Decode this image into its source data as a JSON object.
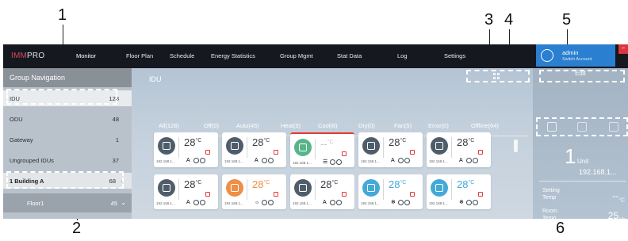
{
  "callouts": [
    "1",
    "2",
    "3",
    "4",
    "5",
    "6"
  ],
  "app": {
    "logo_part1": "IMM",
    "logo_part2": "PRO"
  },
  "nav": [
    "Monitor",
    "Floor Plan",
    "Schedule",
    "Energy Statistics",
    "Group Mgmt",
    "Stat Data",
    "Log",
    "Settings"
  ],
  "user": {
    "name": "admin",
    "action": "Switch Account",
    "close": "−"
  },
  "sidebar": {
    "title": "Group Navigation",
    "items": [
      {
        "label": "IDU",
        "count": "128"
      },
      {
        "label": "ODU",
        "count": "48"
      },
      {
        "label": "Gateway",
        "count": "1"
      },
      {
        "label": "Ungrouped IDUs",
        "count": "37"
      },
      {
        "label": "1  Building A",
        "count": "68"
      },
      {
        "label": "Floor1",
        "count": "45"
      }
    ]
  },
  "main": {
    "title": "IDU",
    "filters": [
      "All(128)",
      "Off(0)",
      "Auto(46)",
      "Heat(5)",
      "Cool(8)",
      "Dry(0)",
      "Fan(5)",
      "Error(0)",
      "Offline(64)"
    ]
  },
  "cards": [
    {
      "temp": "28",
      "unit": "°C",
      "ip": "192.168.1...",
      "mode": "A",
      "style": "dark"
    },
    {
      "temp": "28",
      "unit": "°C",
      "ip": "192.168.1...",
      "mode": "A",
      "style": "dark"
    },
    {
      "temp": "--",
      "unit": "°C",
      "ip": "192.168.1...",
      "mode": "☰",
      "style": "green"
    },
    {
      "temp": "28",
      "unit": "°C",
      "ip": "192.168.1...",
      "mode": "A",
      "style": "dark"
    },
    {
      "temp": "28",
      "unit": "°C",
      "ip": "192.168.1...",
      "mode": "A",
      "style": "dark"
    },
    {
      "temp": "28",
      "unit": "°C",
      "ip": "192.168.1...",
      "mode": "A",
      "style": "dark"
    },
    {
      "temp": "28",
      "unit": "°C",
      "ip": "192.168.1...",
      "mode": "☼",
      "style": "orange"
    },
    {
      "temp": "28",
      "unit": "°C",
      "ip": "192.168.1...",
      "mode": "A",
      "style": "dark"
    },
    {
      "temp": "28",
      "unit": "°C",
      "ip": "192.168.1...",
      "mode": "❄",
      "style": "blue"
    },
    {
      "temp": "28",
      "unit": "°C",
      "ip": "192.168.1...",
      "mode": "❄",
      "style": "blue"
    }
  ],
  "right_panel": {
    "edit": "Edit",
    "count": "1",
    "unit_label": "Unit",
    "ip": "192.168.1...",
    "setting_label": "Setting\nTemp",
    "setting_value": "--",
    "room_label": "Room\nTemp",
    "room_value": "25",
    "temp_unit": "°C"
  },
  "colors": {
    "topbar": "#15181f",
    "accent": "#2a7fd0",
    "error": "#e23b3b",
    "heat": "#ee8f45",
    "cool": "#45a9d8",
    "fan": "#57b58a"
  },
  "icons": [
    "user-avatar-icon",
    "grid-view-icon",
    "lock-icon",
    "chevron-down-icon",
    "tab-unit-icon",
    "tab-list-icon",
    "tab-grid-icon"
  ]
}
